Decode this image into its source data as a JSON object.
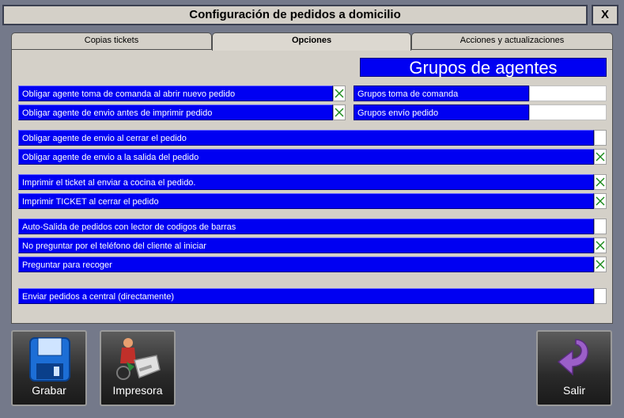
{
  "window": {
    "title": "Configuración de pedidos a domicilio",
    "close_label": "X"
  },
  "tabs": [
    {
      "label": "Copias tickets",
      "active": false
    },
    {
      "label": "Opciones",
      "active": true
    },
    {
      "label": "Acciones y actualizaciones",
      "active": false
    }
  ],
  "options": [
    {
      "label": "Obligar agente toma de comanda al abrir nuevo pedido",
      "checked": true
    },
    {
      "label": "Obligar agente de envio antes de imprimir pedido",
      "checked": true
    },
    {
      "label": "Obligar agente de envio al cerrar el pedido",
      "checked": false
    },
    {
      "label": "Obligar agente de envio a la salida del pedido",
      "checked": true
    },
    {
      "label": "Imprimir el ticket al enviar a cocina  el pedido.",
      "checked": true
    },
    {
      "label": "Imprimir TICKET al cerrar el pedido",
      "checked": true
    },
    {
      "label": "Auto-Salida de pedidos con lector de codigos de barras",
      "checked": false
    },
    {
      "label": "No preguntar por el teléfono del cliente al iniciar",
      "checked": true
    },
    {
      "label": "Preguntar para recoger",
      "checked": true
    },
    {
      "label": "Enviar pedidos a central (directamente)",
      "checked": false
    }
  ],
  "agent_groups": {
    "header": "Grupos de agentes",
    "rows": [
      {
        "label": "Grupos toma de comanda",
        "value": ""
      },
      {
        "label": "Grupos envío pedido",
        "value": ""
      }
    ]
  },
  "buttons": {
    "save_label": "Grabar",
    "printer_label": "Impresora",
    "exit_label": "Salir"
  },
  "colors": {
    "accent_blue": "#0000f2",
    "panel": "#d4d0c8",
    "check_green": "#1a8a1a"
  }
}
